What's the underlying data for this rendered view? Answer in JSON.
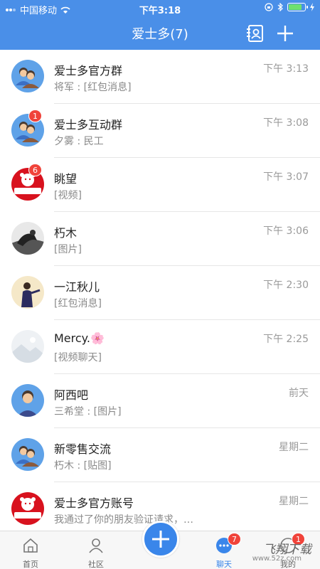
{
  "status_bar": {
    "carrier": "中国移动",
    "time": "下午3:18"
  },
  "header": {
    "title": "爱士多(7)"
  },
  "chats": [
    {
      "name": "爱士多官方群",
      "preview": "将军 : [红包消息]",
      "time": "下午 3:13",
      "badge": "",
      "avatar": "group-avatar-icon"
    },
    {
      "name": "爱士多互动群",
      "preview": "夕雾 : 民工",
      "time": "下午 3:08",
      "badge": "1",
      "avatar": "group-avatar-icon"
    },
    {
      "name": "眺望",
      "preview": "[视频]",
      "time": "下午 3:07",
      "badge": "6",
      "avatar": "store-logo-avatar"
    },
    {
      "name": "朽木",
      "preview": "[图片]",
      "time": "下午 3:06",
      "badge": "",
      "avatar": "photo-avatar"
    },
    {
      "name": "一江秋儿",
      "preview": "[红包消息]",
      "time": "下午 2:30",
      "badge": "",
      "avatar": "photo-avatar"
    },
    {
      "name": "Mercy.🌸",
      "preview": "[视频聊天]",
      "time": "下午 2:25",
      "badge": "",
      "avatar": "photo-avatar"
    },
    {
      "name": "阿西吧",
      "preview": "三希堂 : [图片]",
      "time": "前天",
      "badge": "",
      "avatar": "person-avatar-icon"
    },
    {
      "name": "新零售交流",
      "preview": "朽木 : [贴图]",
      "time": "星期二",
      "badge": "",
      "avatar": "group-avatar-icon"
    },
    {
      "name": "爱士多官方账号",
      "preview": "我通过了你的朋友验证请求，…",
      "time": "星期二",
      "badge": "",
      "avatar": "store-logo-avatar"
    }
  ],
  "tabs": [
    {
      "label": "首页",
      "icon": "home-icon"
    },
    {
      "label": "社区",
      "icon": "community-icon"
    },
    {
      "label": "聊天",
      "icon": "chat-icon",
      "badge": "7"
    },
    {
      "label": "我的",
      "icon": "profile-icon",
      "badge": "1"
    }
  ],
  "watermark": {
    "text": "飞翔下载",
    "sub": "www.52z.com"
  },
  "colors": {
    "primary": "#4a8fe8",
    "badge": "#f0433a"
  }
}
